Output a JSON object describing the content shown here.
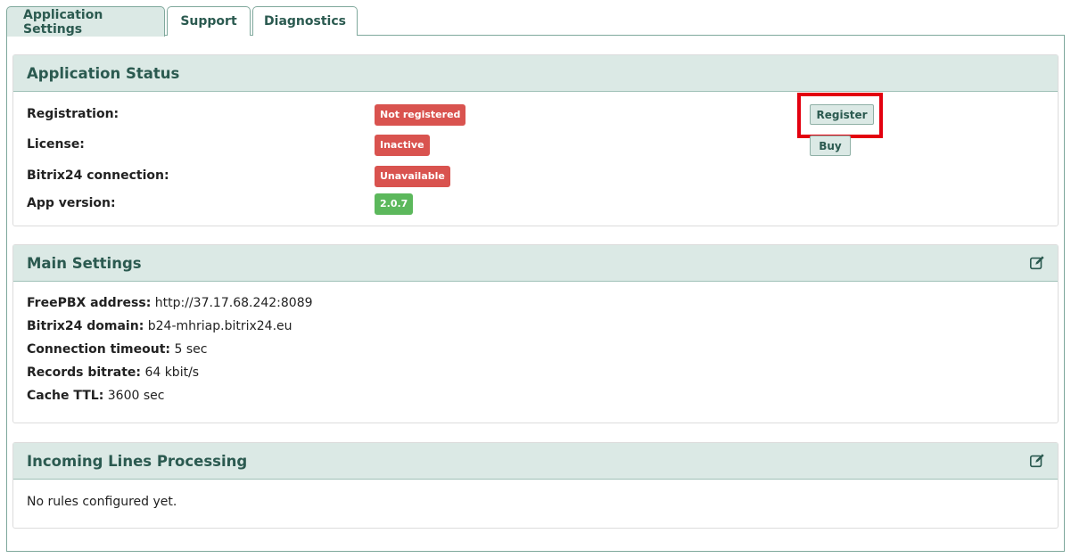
{
  "tabs": [
    {
      "label": "Application Settings",
      "active": true
    },
    {
      "label": "Support",
      "active": false
    },
    {
      "label": "Diagnostics",
      "active": false
    }
  ],
  "status": {
    "title": "Application Status",
    "rows": [
      {
        "label": "Registration:",
        "badge": "Not registered",
        "badge_color": "#d9534f"
      },
      {
        "label": "License:",
        "badge": "Inactive",
        "badge_color": "#d9534f"
      },
      {
        "label": "Bitrix24 connection:",
        "badge": "Unavailable",
        "badge_color": "#d9534f"
      },
      {
        "label": "App version:",
        "badge": "2.0.7",
        "badge_color": "#5cb85c"
      }
    ],
    "register_label": "Register",
    "buy_label": "Buy",
    "highlight_color": "#e3000f"
  },
  "main_settings": {
    "title": "Main Settings",
    "edit_icon": "edit-icon",
    "items": [
      {
        "label": "FreePBX address:",
        "value": "http://37.17.68.242:8089"
      },
      {
        "label": "Bitrix24 domain:",
        "value": "b24-mhriap.bitrix24.eu"
      },
      {
        "label": "Connection timeout:",
        "value": "5 sec"
      },
      {
        "label": "Records bitrate:",
        "value": "64 kbit/s"
      },
      {
        "label": "Cache TTL:",
        "value": "3600 sec"
      }
    ]
  },
  "incoming": {
    "title": "Incoming Lines Processing",
    "edit_icon": "edit-icon",
    "empty_text": "No rules configured yet."
  },
  "colors": {
    "accent_text": "#2b5a50",
    "panel_header_bg": "#dbe9e5",
    "danger": "#d9534f",
    "success": "#5cb85c"
  }
}
